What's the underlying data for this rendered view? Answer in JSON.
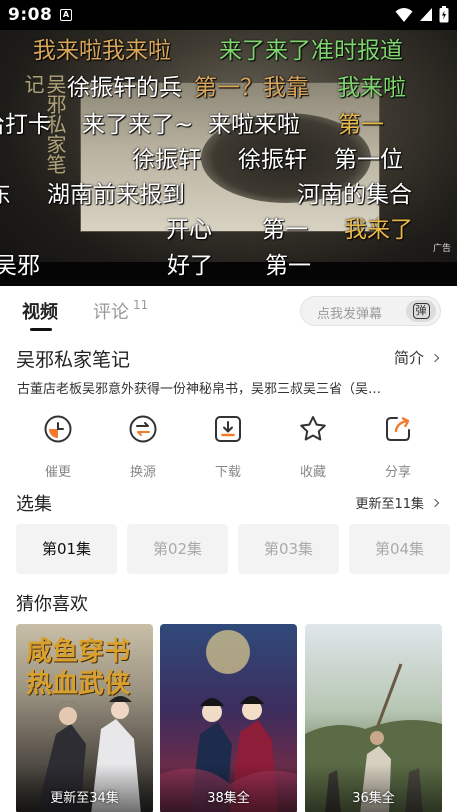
{
  "status_bar": {
    "time": "9:08",
    "notification_icon": "A"
  },
  "video": {
    "calligraphy": "吴邪私家笔记",
    "poster_caption": "徐振轩",
    "corner_tag": "广告",
    "danmaku": [
      {
        "text": "我来啦我来啦",
        "color": "#d9a65c"
      },
      {
        "text": "来了来了准时报道",
        "color": "#7fd66e"
      },
      {
        "text": "徐振轩的兵",
        "color": "#ffffff"
      },
      {
        "text": "第一？我靠",
        "color": "#d9a65c"
      },
      {
        "text": "我来啦",
        "color": "#7fd66e"
      },
      {
        "text": "来了来了~",
        "color": "#ffffff"
      },
      {
        "text": "来啦来啦",
        "color": "#ffffff"
      },
      {
        "text": "第一",
        "color": "#e8b84a"
      },
      {
        "text": "徐振轩",
        "color": "#ffffff"
      },
      {
        "text": "徐振轩",
        "color": "#ffffff"
      },
      {
        "text": "第一位",
        "color": "#ffffff"
      },
      {
        "text": "湖南前来报到",
        "color": "#ffffff"
      },
      {
        "text": "河南的集合",
        "color": "#ffffff"
      },
      {
        "text": "开心",
        "color": "#ffffff"
      },
      {
        "text": "第一",
        "color": "#ffffff"
      },
      {
        "text": "我来了",
        "color": "#e8b84a"
      },
      {
        "text": "好了",
        "color": "#ffffff"
      },
      {
        "text": "第一",
        "color": "#ffffff"
      },
      {
        "text": "吴邪",
        "color": "#ffffff"
      },
      {
        "text": "东",
        "color": "#ffffff"
      },
      {
        "text": "给打卡",
        "color": "#ffffff"
      }
    ]
  },
  "tabs": {
    "video": "视频",
    "comment": "评论",
    "comment_count": "11"
  },
  "danmaku_input": {
    "placeholder": "点我发弹幕",
    "button": "弹"
  },
  "show": {
    "title": "吴邪私家笔记",
    "intro_label": "简介",
    "description": "古董店老板吴邪意外获得一份神秘帛书，吴邪三叔吴三省（吴…"
  },
  "actions": [
    {
      "label": "催更",
      "icon": "clock-icon"
    },
    {
      "label": "换源",
      "icon": "switch-source-icon"
    },
    {
      "label": "下载",
      "icon": "download-icon"
    },
    {
      "label": "收藏",
      "icon": "star-icon"
    },
    {
      "label": "分享",
      "icon": "share-icon"
    }
  ],
  "episodes": {
    "title": "选集",
    "update_text": "更新至11集",
    "items": [
      "第01集",
      "第02集",
      "第03集",
      "第04集"
    ],
    "selected": "第01集"
  },
  "recommend": {
    "title": "猜你喜欢",
    "items": [
      {
        "caption": "更新至34集",
        "poster_text": "咸鱼穿书 热血武侠"
      },
      {
        "caption": "38集全",
        "poster_text": ""
      },
      {
        "caption": "36集全",
        "poster_text": ""
      }
    ]
  },
  "colors": {
    "accent": "#f07b2c",
    "danmaku_green": "#7fd66e",
    "danmaku_gold": "#d9a65c"
  }
}
